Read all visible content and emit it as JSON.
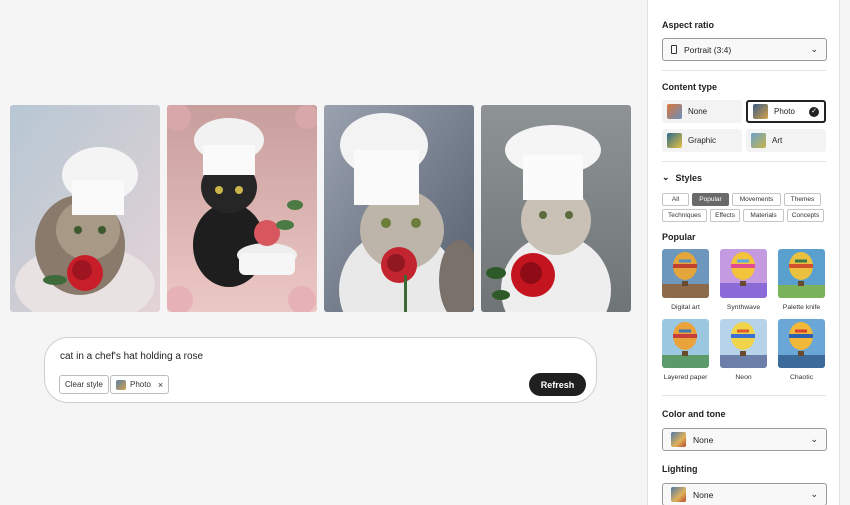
{
  "gallery": [
    {
      "alt": "cat in chef hat with red rose, pastel background"
    },
    {
      "alt": "black cat in chef hat with roses on pink background"
    },
    {
      "alt": "cat in tall chef hat holding a rose"
    },
    {
      "alt": "cat in chef hat beside red rose on grey background"
    }
  ],
  "prompt": {
    "text": "cat in a chef's hat holding a rose",
    "clear_style_label": "Clear style",
    "chip_label": "Photo",
    "chip_remove": "×",
    "refresh_label": "Refresh"
  },
  "panel": {
    "aspect_ratio": {
      "title": "Aspect ratio",
      "value": "Portrait (3:4)"
    },
    "content_type": {
      "title": "Content type",
      "items": [
        {
          "label": "None",
          "selected": false
        },
        {
          "label": "Photo",
          "selected": true
        },
        {
          "label": "Graphic",
          "selected": false
        },
        {
          "label": "Art",
          "selected": false
        }
      ]
    },
    "styles": {
      "title": "Styles",
      "tags": [
        "All",
        "Popular",
        "Movements",
        "Themes",
        "Techniques",
        "Effects",
        "Materials",
        "Concepts"
      ],
      "active_tag": "Popular",
      "section_title": "Popular",
      "thumbs": [
        "Digital art",
        "Synthwave",
        "Palette knife",
        "Layered paper",
        "Neon",
        "Chaotic"
      ]
    },
    "color_tone": {
      "title": "Color and tone",
      "value": "None"
    },
    "lighting": {
      "title": "Lighting",
      "value": "None"
    }
  },
  "colors": {
    "accent": "#1f1f1f",
    "panel_bg": "#ffffff",
    "page_bg": "#f5f5f5"
  }
}
